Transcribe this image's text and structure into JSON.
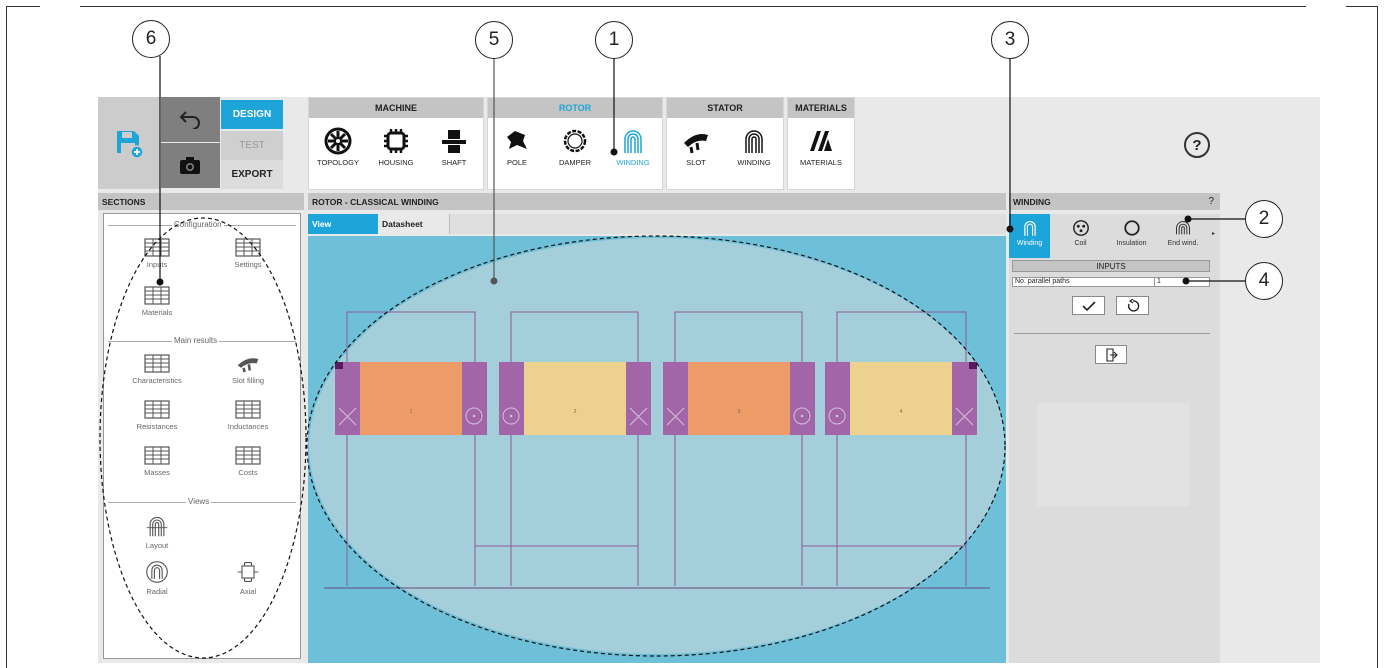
{
  "toolbar": {
    "design_label": "DESIGN",
    "test_label": "TEST",
    "export_label": "EXPORT",
    "help_symbol": "?",
    "groups": [
      {
        "title": "MACHINE",
        "active": false,
        "tools": [
          {
            "label": "TOPOLOGY",
            "icon": "topology-icon"
          },
          {
            "label": "HOUSING",
            "icon": "housing-icon"
          },
          {
            "label": "SHAFT",
            "icon": "shaft-icon"
          }
        ]
      },
      {
        "title": "ROTOR",
        "active": true,
        "tools": [
          {
            "label": "POLE",
            "icon": "pole-icon"
          },
          {
            "label": "DAMPER",
            "icon": "damper-icon"
          },
          {
            "label": "WINDING",
            "icon": "winding-icon",
            "active": true
          }
        ]
      },
      {
        "title": "STATOR",
        "active": false,
        "tools": [
          {
            "label": "SLOT",
            "icon": "slot-icon"
          },
          {
            "label": "WINDING",
            "icon": "winding-icon"
          }
        ]
      },
      {
        "title": "MATERIALS",
        "active": false,
        "tools": [
          {
            "label": "MATERIALS",
            "icon": "materials-icon"
          }
        ]
      }
    ]
  },
  "sections": {
    "header": "SECTIONS",
    "configuration_label": "Configuration",
    "main_results_label": "Main results",
    "views_label": "Views",
    "items": {
      "inputs": "Inputs",
      "settings": "Settings",
      "materials": "Materials",
      "characteristics": "Characteristics",
      "slot_filling": "Slot filling",
      "resistances": "Resistances",
      "inductances": "Inductances",
      "masses": "Masses",
      "costs": "Costs",
      "layout": "Layout",
      "radial": "Radial",
      "axial": "Axial"
    }
  },
  "center": {
    "header": "ROTOR - CLASSICAL WINDING",
    "tab_view": "View",
    "tab_datasheet": "Datasheet",
    "coil_numbers": [
      "1",
      "2",
      "3",
      "4"
    ]
  },
  "right": {
    "header": "WINDING",
    "help_symbol": "?",
    "tabs": [
      {
        "label": "Winding",
        "active": true
      },
      {
        "label": "Coil"
      },
      {
        "label": "Insulation"
      },
      {
        "label": "End wind."
      }
    ],
    "inputs_title": "INPUTS",
    "param_label": "No. parallel paths",
    "param_value": "1"
  },
  "callouts": {
    "c1": "1",
    "c2": "2",
    "c3": "3",
    "c4": "4",
    "c5": "5",
    "c6": "6"
  },
  "colors": {
    "accent": "#1da4d8",
    "canvas_bg": "#6ec0d9",
    "coil_orange": "#ee9b6a",
    "coil_yellow": "#ecd28e",
    "slot_purple": "#a265a8"
  }
}
